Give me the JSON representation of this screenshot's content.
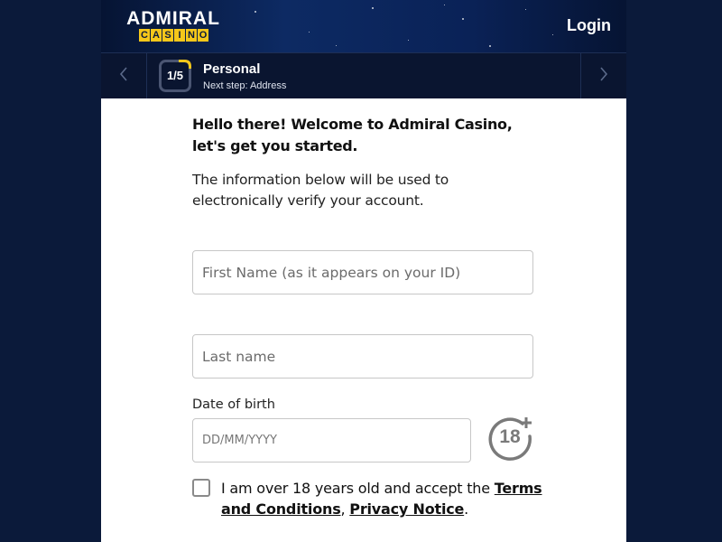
{
  "header": {
    "logo_word": "ADMIRAL",
    "logo_sub_letters": [
      "C",
      "A",
      "S",
      "I",
      "N",
      "O"
    ],
    "login_label": "Login"
  },
  "stepper": {
    "badge": "1/5",
    "progress": 0.2,
    "title": "Personal",
    "next_step": "Next step: Address",
    "prev_icon": "chevron-left-icon",
    "next_icon": "chevron-right-icon"
  },
  "form": {
    "greeting": "Hello there! Welcome to Admiral Casino, let's get you started.",
    "info": "The information below will be used to electronically verify your account.",
    "first_name_placeholder": "First Name (as it appears on your ID)",
    "last_name_placeholder": "Last name",
    "dob_label": "Date of birth",
    "dob_placeholder": "DD/MM/YYYY",
    "age_badge": "18",
    "age_icon": "age-18-plus-icon",
    "consent_prefix": "I am over 18 years old and accept the ",
    "terms_link": "Terms and Conditions",
    "consent_sep": ", ",
    "privacy_link": "Privacy Notice",
    "consent_suffix": "."
  },
  "colors": {
    "background": "#0b1a3a",
    "accent_yellow": "#f5c71a",
    "card": "#ffffff"
  }
}
